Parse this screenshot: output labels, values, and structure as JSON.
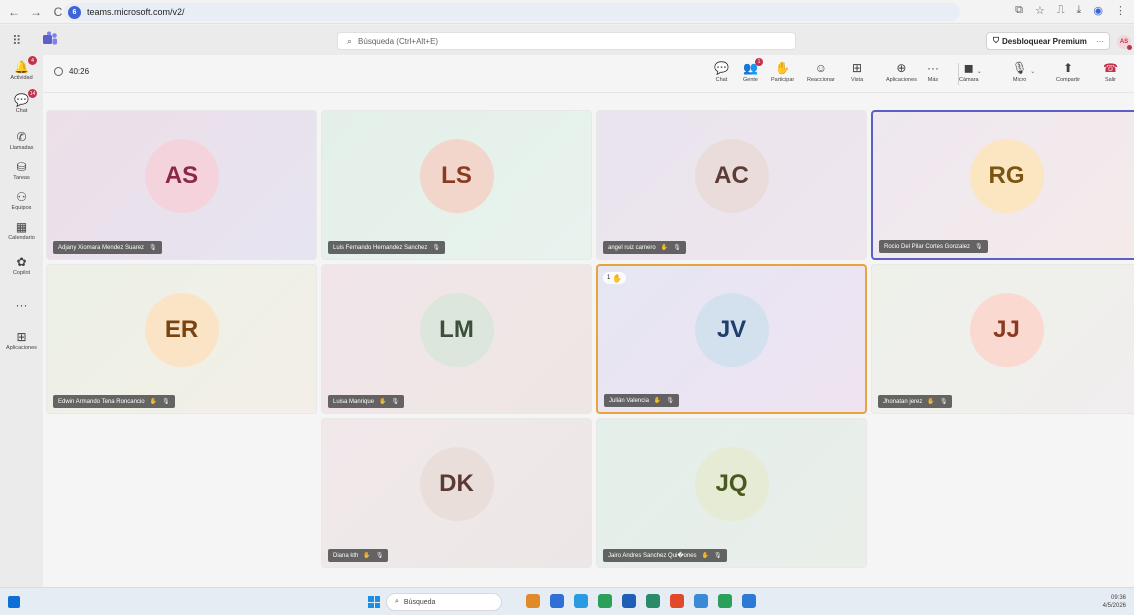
{
  "browser": {
    "url": "teams.microsoft.com/v2/",
    "back": "←",
    "forward": "→",
    "reload": "C",
    "site_icon": "6"
  },
  "top": {
    "search_placeholder": "Búsqueda (Ctrl+Alt+E)",
    "premium_label": "Desbloquear Premium",
    "more": "···",
    "avatar": "AS"
  },
  "rail": [
    {
      "id": "actividad",
      "label": "Actividad",
      "icon": "bell-icon",
      "glyph": "🔔",
      "badge": "4"
    },
    {
      "id": "chat",
      "label": "Chat",
      "icon": "chat-icon",
      "glyph": "💬",
      "badge": "14"
    },
    {
      "id": "llamadas",
      "label": "Llamadas",
      "icon": "phone-icon",
      "glyph": "✆",
      "badge": ""
    },
    {
      "id": "tareas",
      "label": "Tareas",
      "icon": "tasks-icon",
      "glyph": "⛁",
      "badge": ""
    },
    {
      "id": "equipos",
      "label": "Equipos",
      "icon": "teams-icon",
      "glyph": "⚇",
      "badge": ""
    },
    {
      "id": "calendario",
      "label": "Calendario",
      "icon": "calendar-icon",
      "glyph": "▦",
      "badge": ""
    },
    {
      "id": "copilot",
      "label": "Copilot",
      "icon": "copilot-icon",
      "glyph": "✿",
      "badge": ""
    },
    {
      "id": "more",
      "label": "",
      "icon": "more-icon",
      "glyph": "···",
      "badge": ""
    },
    {
      "id": "aplicaciones",
      "label": "Aplicaciones",
      "icon": "apps-icon",
      "glyph": "⊞",
      "badge": ""
    }
  ],
  "meeting": {
    "timer": "40:26",
    "tools": [
      {
        "id": "chat",
        "label": "Chat",
        "icon": "chat-icon",
        "glyph": "💬"
      },
      {
        "id": "gente",
        "label": "Gente",
        "icon": "people-icon",
        "glyph": "👥",
        "badge": "1"
      },
      {
        "id": "participar",
        "label": "Participar",
        "icon": "raise-hand-icon",
        "glyph": "✋"
      },
      {
        "id": "reaccionar",
        "label": "Reaccionar",
        "icon": "emoji-icon",
        "glyph": "☺"
      },
      {
        "id": "vista",
        "label": "Vista",
        "icon": "grid-icon",
        "glyph": "⊞"
      },
      {
        "id": "aplicaciones",
        "label": "Aplicaciones",
        "icon": "add-app-icon",
        "glyph": "⊕"
      },
      {
        "id": "mas",
        "label": "Más",
        "icon": "more-icon",
        "glyph": "···"
      },
      {
        "id": "camara",
        "label": "Cámara",
        "icon": "camera-off-icon",
        "glyph": "◼"
      },
      {
        "id": "micro",
        "label": "Micro",
        "icon": "mic-off-icon",
        "glyph": "🎙"
      },
      {
        "id": "compartir",
        "label": "Compartir",
        "icon": "share-icon",
        "glyph": "⬆"
      },
      {
        "id": "salir",
        "label": "Salir",
        "icon": "hang-up-icon",
        "glyph": "☎"
      }
    ]
  },
  "participants": [
    {
      "initials": "AS",
      "name": "Adjany Xiomara Mendez Suarez",
      "bg": "linear-gradient(135deg,#ecdfe8,#e6e4f1)",
      "av_bg": "#f4d3dc",
      "av_fg": "#8a2846",
      "status": "",
      "active": ""
    },
    {
      "initials": "LS",
      "name": "Luis Fernando Hernandez Sanchez",
      "bg": "linear-gradient(135deg,#e4efe9,#e8f3ee)",
      "av_bg": "#f3d6cb",
      "av_fg": "#8a3a20",
      "status": "",
      "active": ""
    },
    {
      "initials": "AC",
      "name": "angel ruiz camero",
      "bg": "linear-gradient(135deg,#e9e4ee,#efe6ee)",
      "av_bg": "#e9dcda",
      "av_fg": "#5c3c36",
      "status": "✋",
      "active": ""
    },
    {
      "initials": "RG",
      "name": "Rocio Del Pilar Cortes Gonzalez",
      "bg": "linear-gradient(135deg,#eee8ef,#f4eaea)",
      "av_bg": "#fbe6c1",
      "av_fg": "#7a5410",
      "status": "",
      "active": "blue"
    },
    {
      "initials": "ER",
      "name": "Edwin Armando Tena Roncancio",
      "bg": "linear-gradient(135deg,#ecf0e6,#f3efe8)",
      "av_bg": "#fbe3c6",
      "av_fg": "#7a4410",
      "status": "✋",
      "active": ""
    },
    {
      "initials": "LM",
      "name": "Luisa Manrique",
      "bg": "linear-gradient(135deg,#f1e5ea,#eee6e4)",
      "av_bg": "#dde6dc",
      "av_fg": "#3c4f3a",
      "status": "✋",
      "active": ""
    },
    {
      "initials": "JV",
      "name": "Julián Valencia",
      "bg": "linear-gradient(135deg,#e6e6f3,#efe3f1)",
      "av_bg": "#d3e0ee",
      "av_fg": "#1f3f6a",
      "status": "✋",
      "active": "orange",
      "hand": "1"
    },
    {
      "initials": "JJ",
      "name": "Jhonatan jerez",
      "bg": "linear-gradient(135deg,#eef0ea,#f0eeee)",
      "av_bg": "#fad9d1",
      "av_fg": "#8a3a20",
      "status": "✋",
      "active": ""
    },
    {
      "initials": "DK",
      "name": "Diana kth",
      "bg": "linear-gradient(135deg,#f1e8ea,#ece7e6)",
      "av_bg": "#eadedb",
      "av_fg": "#5a3a32",
      "status": "✋",
      "active": ""
    },
    {
      "initials": "JQ",
      "name": "Jairo Andres Sanchez Qui�ones",
      "bg": "linear-gradient(135deg,#e3efe9,#eaeee9)",
      "av_bg": "#e6ebd6",
      "av_fg": "#4a5a1e",
      "status": "✋",
      "active": ""
    }
  ],
  "taskbar": {
    "search_placeholder": "Búsqueda",
    "time": "09:36",
    "date": "4/5/2026",
    "apps": [
      "#e08a2a",
      "#2f6fd6",
      "#2a9be0",
      "#2aa05a",
      "#1f5fb5",
      "#2a8a6a",
      "#e04a2a",
      "#3a8ad6",
      "#2aa05a",
      "#2a7ad6"
    ]
  }
}
